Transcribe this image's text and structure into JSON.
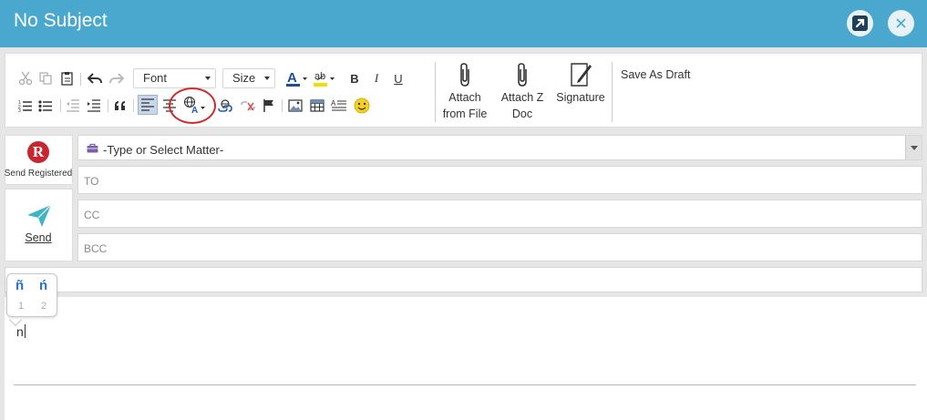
{
  "window": {
    "title": "No Subject"
  },
  "toolbar": {
    "font_label": "Font",
    "size_label": "Size",
    "bold_label": "B",
    "italic_label": "I",
    "underline_label": "U",
    "attach_file": {
      "line1": "Attach",
      "line2": "from File"
    },
    "attach_z": {
      "line1": "Attach Z",
      "line2": "Doc"
    },
    "signature_label": "Signature",
    "save_draft_label": "Save As Draft"
  },
  "actions": {
    "registered_icon": "R",
    "registered_label": "Send Registered",
    "send_label": "Send"
  },
  "fields": {
    "matter_placeholder": "-Type or Select Matter-",
    "to_label": "TO",
    "cc_label": "CC",
    "bcc_label": "BCC"
  },
  "candidates": [
    {
      "char": "ñ",
      "num": "1"
    },
    {
      "char": "ń",
      "num": "2"
    }
  ],
  "body": {
    "typed_text": "n"
  },
  "colors": {
    "title_bar": "#4aa8cf",
    "highlight_circle": "#d42a2a",
    "accent_blue": "#2a6fcf"
  }
}
